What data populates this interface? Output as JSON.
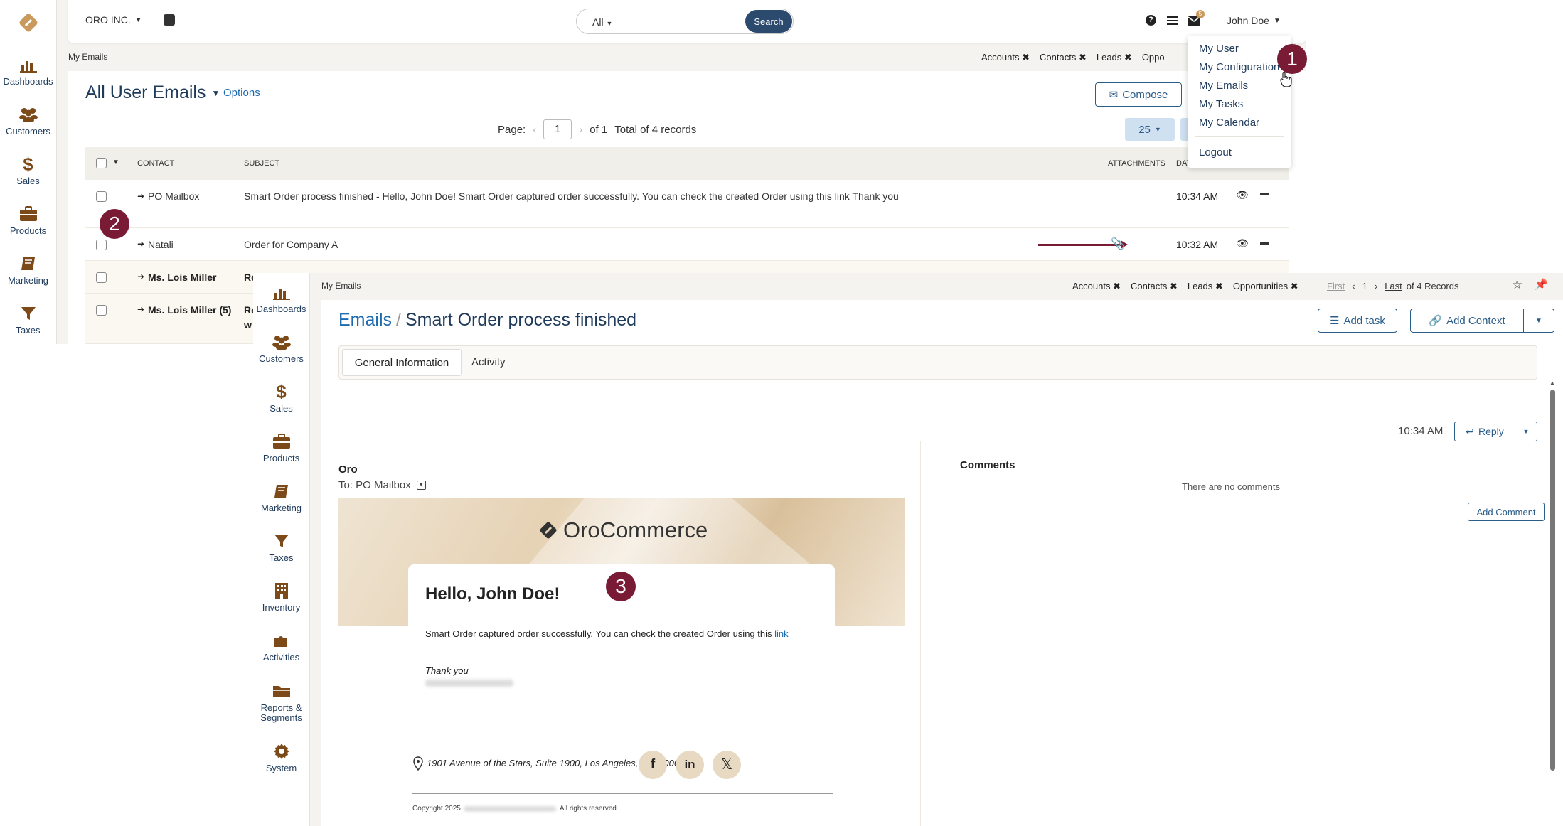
{
  "nav": [
    {
      "label": "Dashboards",
      "icon": "bar-chart-icon"
    },
    {
      "label": "Customers",
      "icon": "users-icon"
    },
    {
      "label": "Sales",
      "icon": "dollar-icon"
    },
    {
      "label": "Products",
      "icon": "briefcase-icon"
    },
    {
      "label": "Marketing",
      "icon": "book-icon"
    },
    {
      "label": "Taxes",
      "icon": "filter-icon"
    }
  ],
  "nav2": [
    {
      "label": "Dashboards",
      "icon": "bar-chart-icon"
    },
    {
      "label": "Customers",
      "icon": "users-icon"
    },
    {
      "label": "Sales",
      "icon": "dollar-icon"
    },
    {
      "label": "Products",
      "icon": "briefcase-icon"
    },
    {
      "label": "Marketing",
      "icon": "book-icon"
    },
    {
      "label": "Taxes",
      "icon": "filter-icon"
    },
    {
      "label": "Inventory",
      "icon": "building-icon"
    },
    {
      "label": "Activities",
      "icon": "puzzle-icon"
    },
    {
      "label": "Reports & Segments",
      "icon": "folder-icon"
    },
    {
      "label": "System",
      "icon": "gear-icon"
    }
  ],
  "topbar": {
    "org": "ORO INC.",
    "search_scope": "All",
    "search_button": "Search",
    "user": "John Doe",
    "mail_count": "5"
  },
  "back": {
    "breadcrumb": "My Emails",
    "pinned": [
      "Accounts",
      "Contacts",
      "Leads",
      "Oppo"
    ],
    "title": "All User Emails",
    "options": "Options",
    "compose": "Compose",
    "page_label": "Page:",
    "page_num": "1",
    "page_of": "of 1",
    "total": "Total of 4 records",
    "per_page": "25",
    "columns": {
      "contact": "CONTACT",
      "subject": "SUBJECT",
      "attachments": "ATTACHMENTS",
      "date": "DAT"
    },
    "rows": [
      {
        "contact": "PO Mailbox",
        "subject": "Smart Order process finished - Hello, John Doe! Smart Order captured order successfully. You can check the created Order using this link Thank you",
        "time": "10:34 AM",
        "bold": false
      },
      {
        "contact": "Natali",
        "subject": "Order for Company A",
        "time": "10:32 AM",
        "bold": false
      },
      {
        "contact": "Ms. Lois Miller",
        "subject": "Re",
        "time": "",
        "bold": true
      },
      {
        "contact": "Ms. Lois Miller (5)",
        "subject": "Re",
        "subject2": "w",
        "time": "",
        "bold": true
      }
    ]
  },
  "user_menu": {
    "items": [
      "My User",
      "My Configuration",
      "My Emails",
      "My Tasks",
      "My Calendar"
    ],
    "logout": "Logout"
  },
  "badges": {
    "one": "1",
    "two": "2",
    "three": "3"
  },
  "front": {
    "breadcrumb": "My Emails",
    "pinned": [
      "Accounts",
      "Contacts",
      "Leads",
      "Opportunities"
    ],
    "pager": {
      "first": "First",
      "page": "1",
      "last": "Last",
      "of": "of 4 Records"
    },
    "title_link": "Emails",
    "title_sep": "/",
    "title": "Smart Order process finished",
    "add_task": "Add task",
    "add_context": "Add Context",
    "tabs": [
      "General Information",
      "Activity"
    ],
    "time": "10:34 AM",
    "reply": "Reply",
    "from": "Oro",
    "to": "To: PO Mailbox",
    "comments_title": "Comments",
    "no_comments": "There are no comments",
    "add_comment": "Add Comment",
    "email": {
      "logo_text": "OroCommerce",
      "greeting": "Hello, John Doe!",
      "body": "Smart Order captured order successfully. You can check the created Order using this",
      "link": "link",
      "thanks": "Thank you",
      "address": "1901 Avenue of the Stars, Suite 1900, Los Angeles, CA, 90067",
      "copyright_pre": "Copyright 2025",
      "copyright_post": ". All rights reserved."
    }
  },
  "colors": {
    "brand": "#7b4a18",
    "accent": "#2b5d8a",
    "badge": "#7a1b36"
  }
}
